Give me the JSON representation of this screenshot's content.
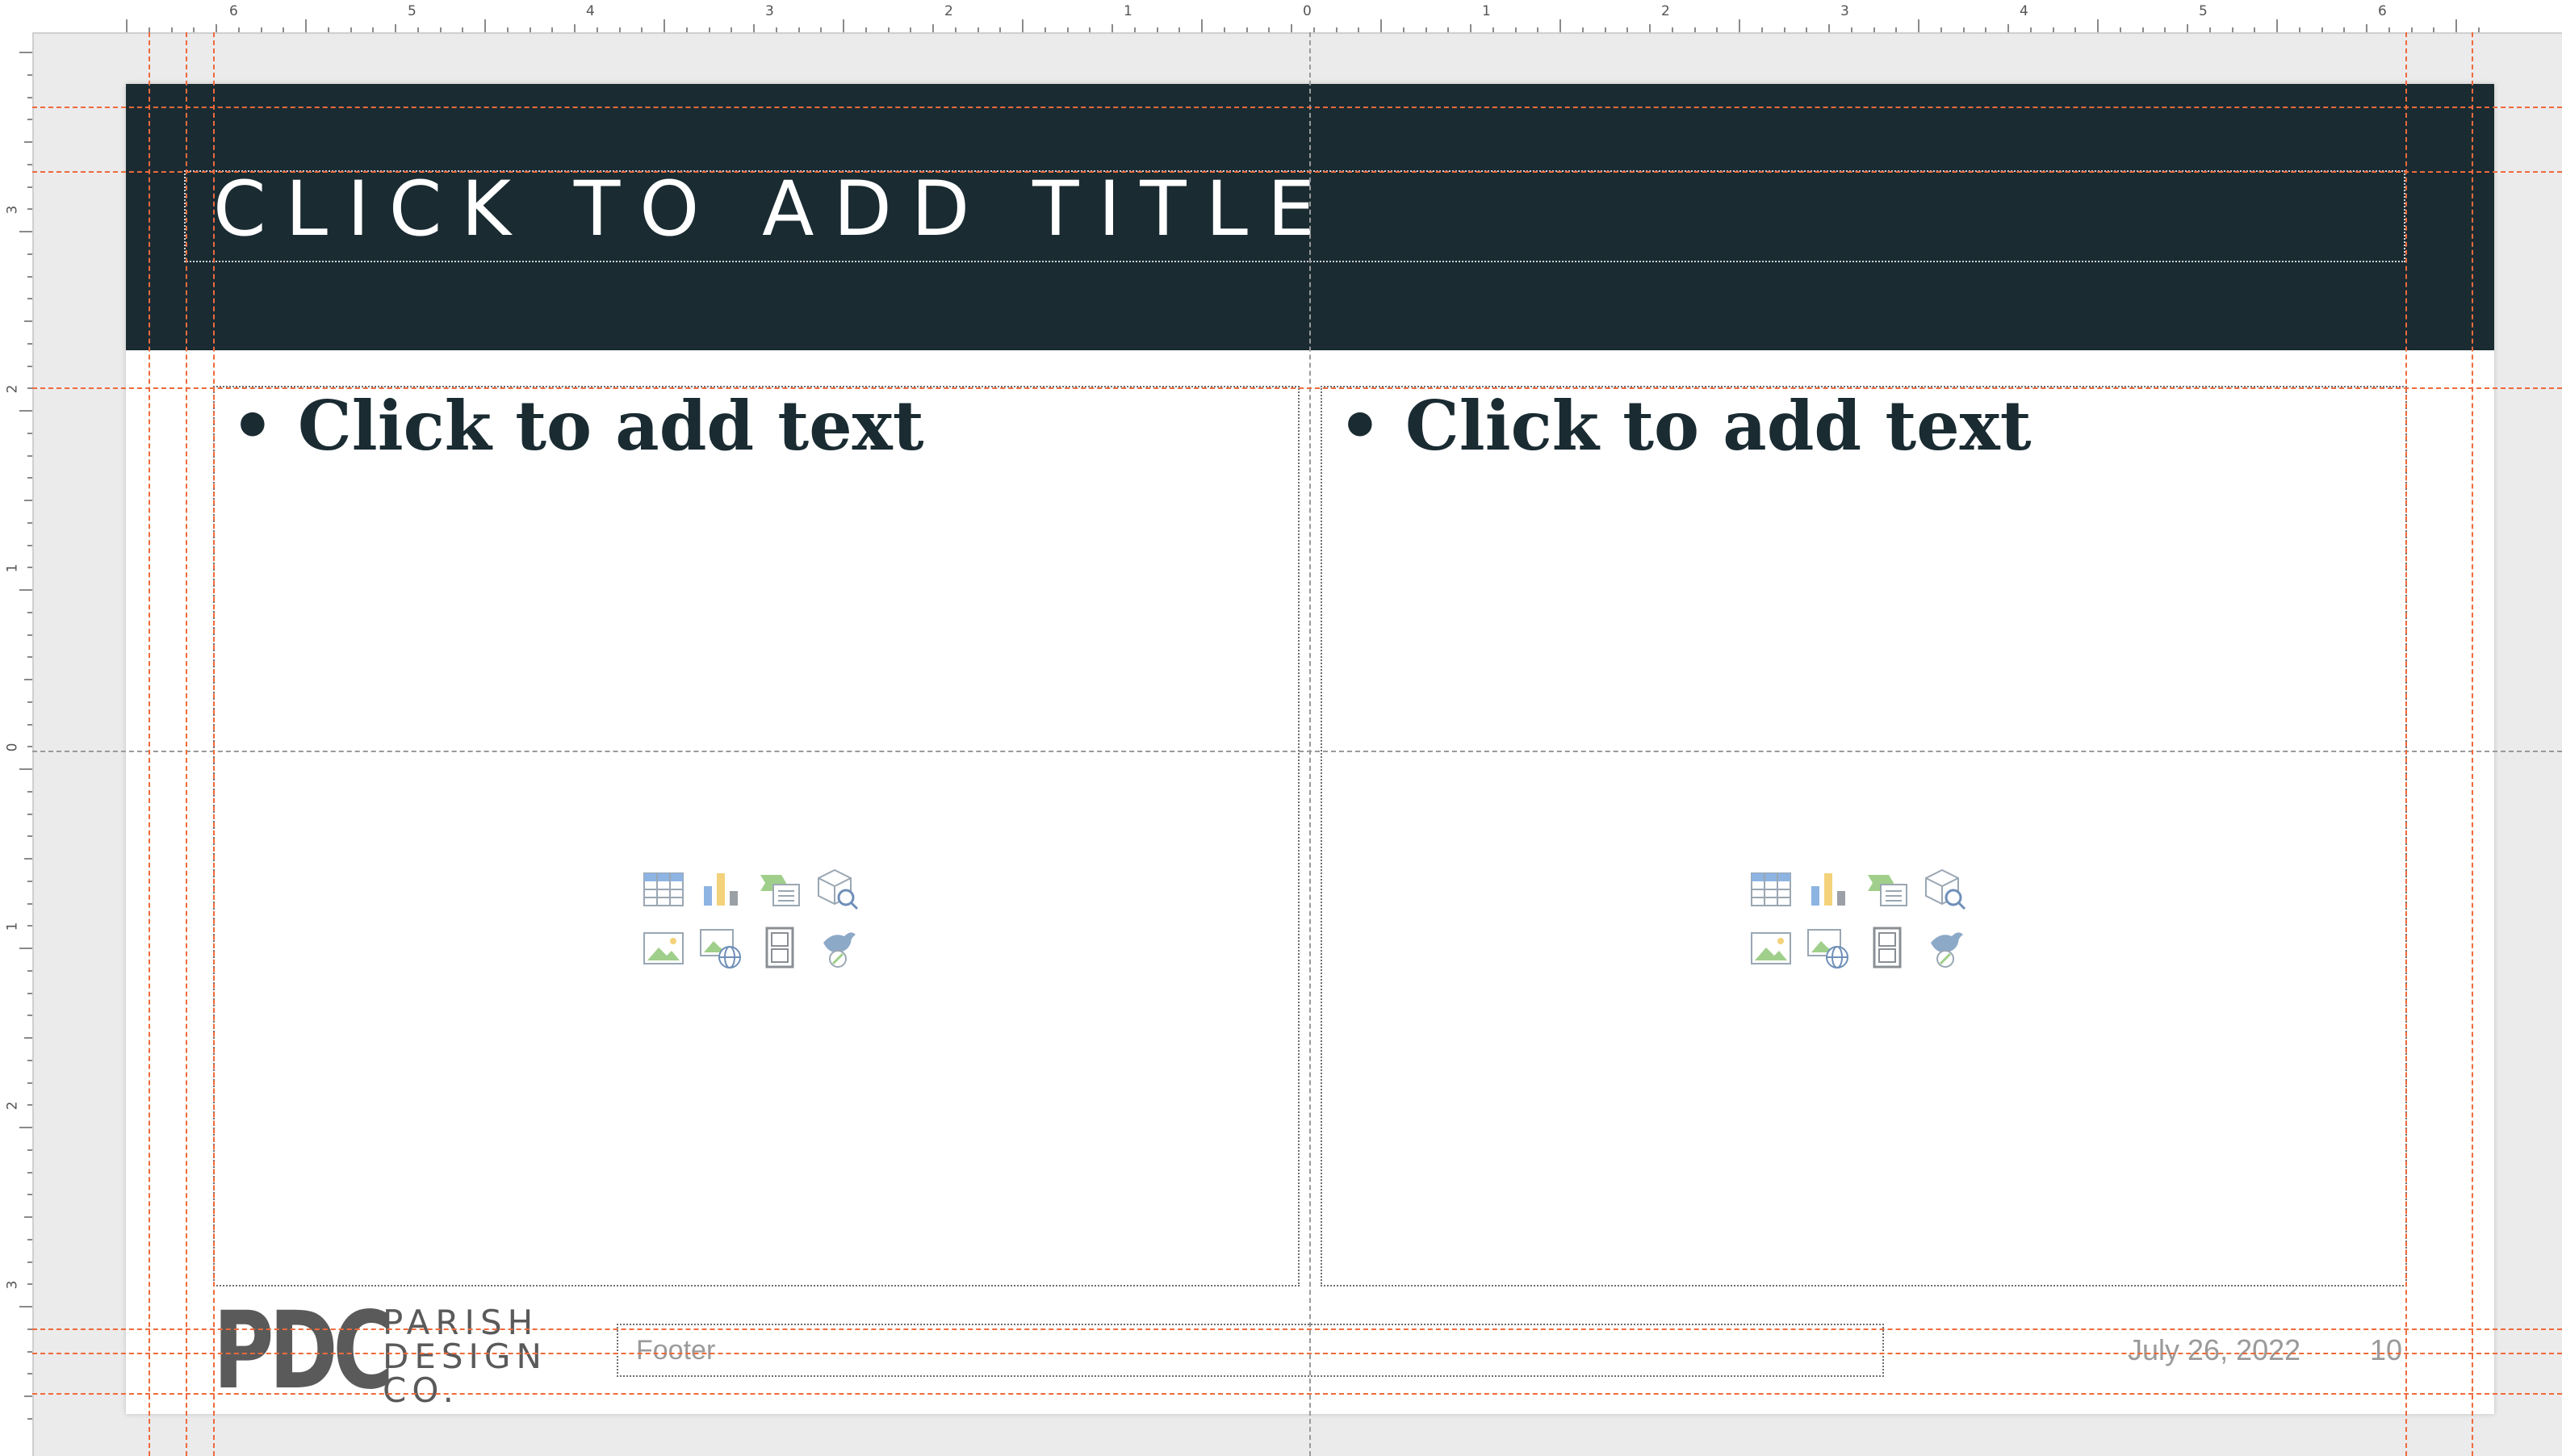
{
  "ruler": {
    "top_labels": [
      "6",
      "5",
      "4",
      "3",
      "2",
      "1",
      "0",
      "1",
      "2",
      "3",
      "4",
      "5",
      "6"
    ],
    "left_labels": [
      "3",
      "2",
      "1",
      "0",
      "1",
      "2",
      "3"
    ]
  },
  "slide": {
    "title_placeholder": "CLICK TO ADD TITLE",
    "left_content": {
      "placeholder": "• Click to add text"
    },
    "right_content": {
      "placeholder": "• Click to add text"
    },
    "content_icons": [
      "table-icon",
      "chart-icon",
      "smartart-icon",
      "3d-model-icon",
      "picture-icon",
      "online-picture-icon",
      "video-icon",
      "icon-icon"
    ],
    "footer_placeholder": "Footer",
    "date": "July 26, 2022",
    "slide_number": "10",
    "logo": {
      "mark": "PDC",
      "line1": "PARISH",
      "line2": "DESIGN",
      "line3": "CO."
    }
  },
  "colors": {
    "title_band": "#1a2b32",
    "guide": "#ef6a3c",
    "body_text": "#1a2b32"
  }
}
